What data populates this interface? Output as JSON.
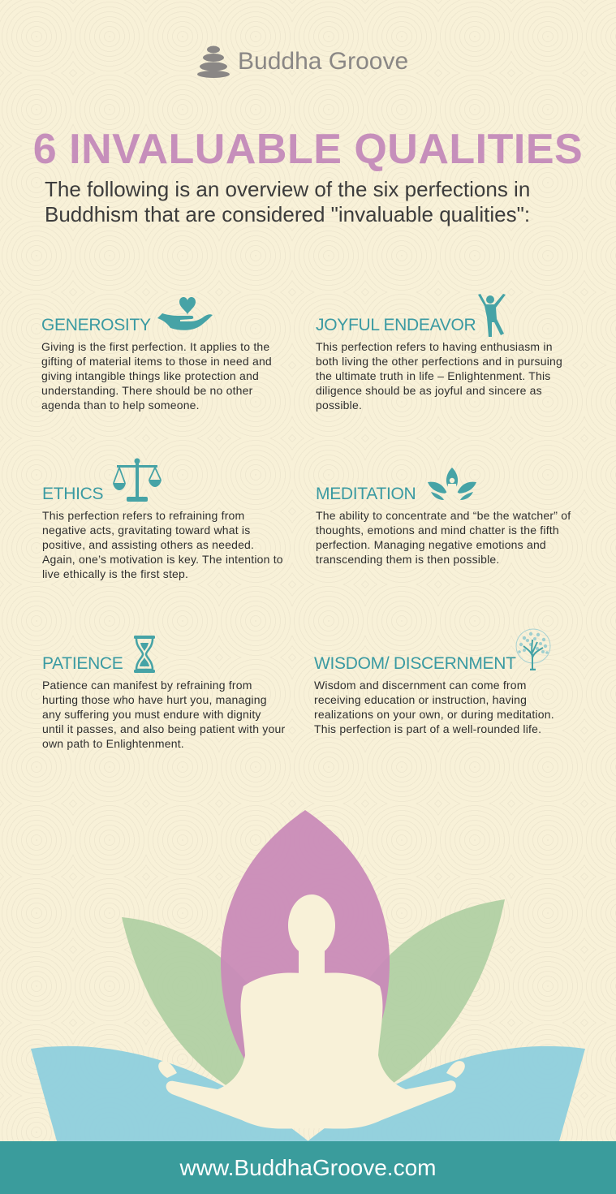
{
  "brand": {
    "name": "Buddha Groove",
    "logo_icon": "stacked-stones-icon"
  },
  "header": {
    "title": "6 INVALUABLE QUALITIES",
    "subtitle": "The following is an overview of the six perfections in Buddhism that are considered \"invaluable qualities\":"
  },
  "qualities": [
    {
      "title": "GENEROSITY",
      "icon": "hand-heart-icon",
      "text": "Giving is the first perfection. It applies to the gifting of material items to those in need and giving intangible things like protection and understanding. There should be no other agenda than to help someone."
    },
    {
      "title": "JOYFUL ENDEAVOR",
      "icon": "joyful-figure-icon",
      "text": "This perfection refers to having enthusiasm in both living the other perfections and in pursuing the ultimate truth in life – Enlightenment. This diligence should be as joyful and sincere as possible."
    },
    {
      "title": "ETHICS",
      "icon": "scales-icon",
      "text": "This perfection refers to refraining from negative acts, gravitating toward what is positive, and assisting others as needed. Again, one’s motivation is key. The intention to live ethically is the first step."
    },
    {
      "title": "MEDITATION",
      "icon": "lotus-meditator-icon",
      "text": "The ability to concentrate and “be the watcher” of thoughts, emotions and mind chatter is the fifth perfection. Managing negative emotions and transcending them is then possible."
    },
    {
      "title": "PATIENCE",
      "icon": "hourglass-icon",
      "text": "Patience can manifest by refraining from hurting those who have hurt you, managing any suffering you must endure with dignity until it passes, and also being patient  with your own path to Enlightenment."
    },
    {
      "title": "WISDOM/ DISCERNMENT",
      "icon": "tree-icon",
      "text": "Wisdom and discernment can come from receiving education or instruction, having realizations on your own, or during meditation. This perfection is part of a well-rounded life."
    }
  ],
  "footer": {
    "url": "www.BuddhaGroove.com"
  },
  "colors": {
    "background": "#f8f1d8",
    "title": "#c68fbb",
    "teal": "#3a9aa2",
    "footer": "#3a9c9c",
    "petal_pink": "#c98bb8",
    "petal_green": "#a9cc9f",
    "petal_blue": "#8ecfdd"
  }
}
